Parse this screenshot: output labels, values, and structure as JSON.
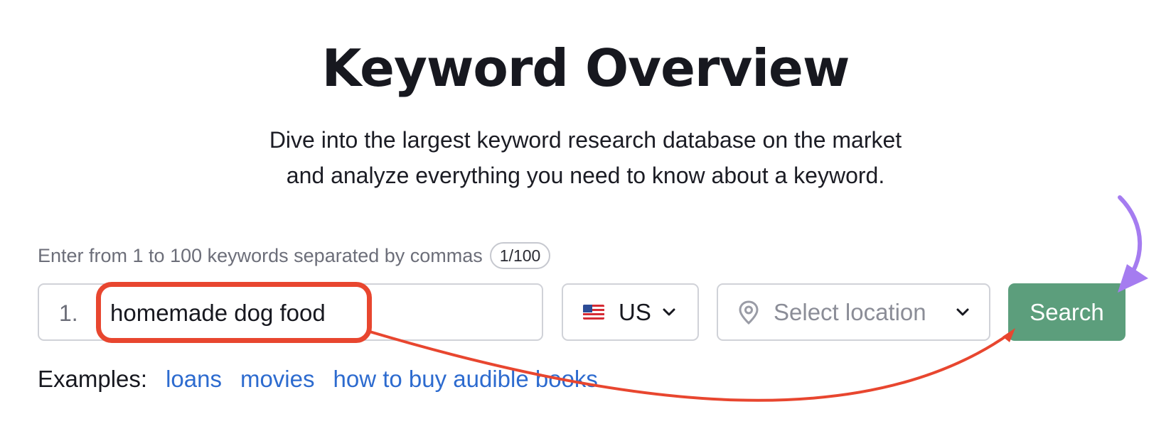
{
  "header": {
    "title": "Keyword Overview",
    "subtitle_line1": "Dive into the largest keyword research database on the market",
    "subtitle_line2": "and analyze everything you need to know about a keyword."
  },
  "form": {
    "hint": "Enter from 1 to 100 keywords separated by commas",
    "counter": "1/100",
    "keyword_index": "1.",
    "keyword_value": "homemade dog food",
    "database": {
      "label": "US",
      "flag_icon": "us-flag-icon"
    },
    "location": {
      "placeholder": "Select location",
      "icon": "location-pin-icon"
    },
    "search_label": "Search"
  },
  "examples": {
    "label": "Examples:",
    "items": [
      "loans",
      "movies",
      "how to buy audible books"
    ]
  },
  "colors": {
    "search_button": "#5c9e7c",
    "link": "#2d6bcf",
    "highlight_outline": "#e8462f",
    "purple_arrow": "#a57cf0"
  }
}
